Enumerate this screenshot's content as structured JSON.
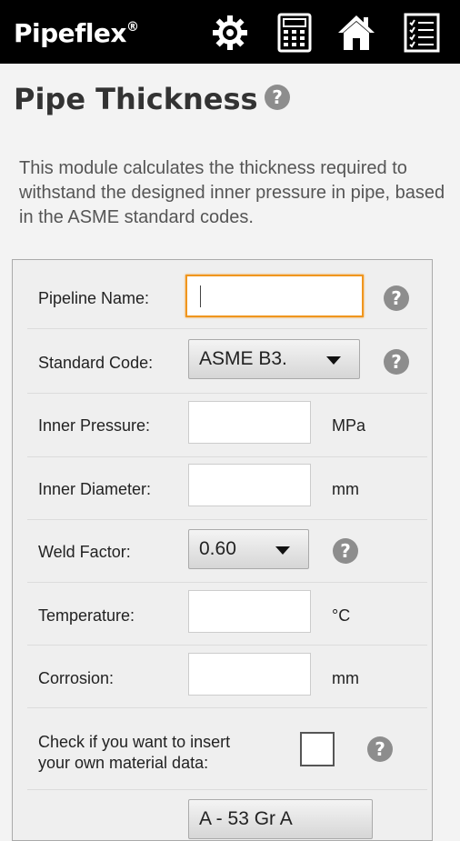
{
  "app": {
    "name": "Pipeflex",
    "registered": "®"
  },
  "page": {
    "title": "Pipe Thickness",
    "description": "This module calculates the thickness required to withstand the designed inner pressure in pipe, based in the ASME standard codes."
  },
  "help_label": "?",
  "form": {
    "pipeline_name": {
      "label": "Pipeline Name:",
      "value": ""
    },
    "standard_code": {
      "label": "Standard Code:",
      "selected": "ASME B3."
    },
    "inner_pressure": {
      "label": "Inner Pressure:",
      "value": "",
      "unit": "MPa"
    },
    "inner_diameter": {
      "label": "Inner Diameter:",
      "value": "",
      "unit": "mm"
    },
    "weld_factor": {
      "label": "Weld Factor:",
      "selected": "0.60"
    },
    "temperature": {
      "label": "Temperature:",
      "value": "",
      "unit": "°C"
    },
    "corrosion": {
      "label": "Corrosion:",
      "value": "",
      "unit": "mm"
    },
    "material_check": {
      "label_line1": "Check if you want to insert",
      "label_line2": "your own material data:",
      "checked": false
    },
    "material": {
      "selected": "A - 53 Gr A"
    }
  },
  "icons": {
    "settings": "gear-icon",
    "calculator": "calculator-icon",
    "home": "home-icon",
    "checklist": "checklist-icon"
  },
  "colors": {
    "appbar": "#000000",
    "focus": "#f0961e",
    "help": "#8d8d8d"
  }
}
